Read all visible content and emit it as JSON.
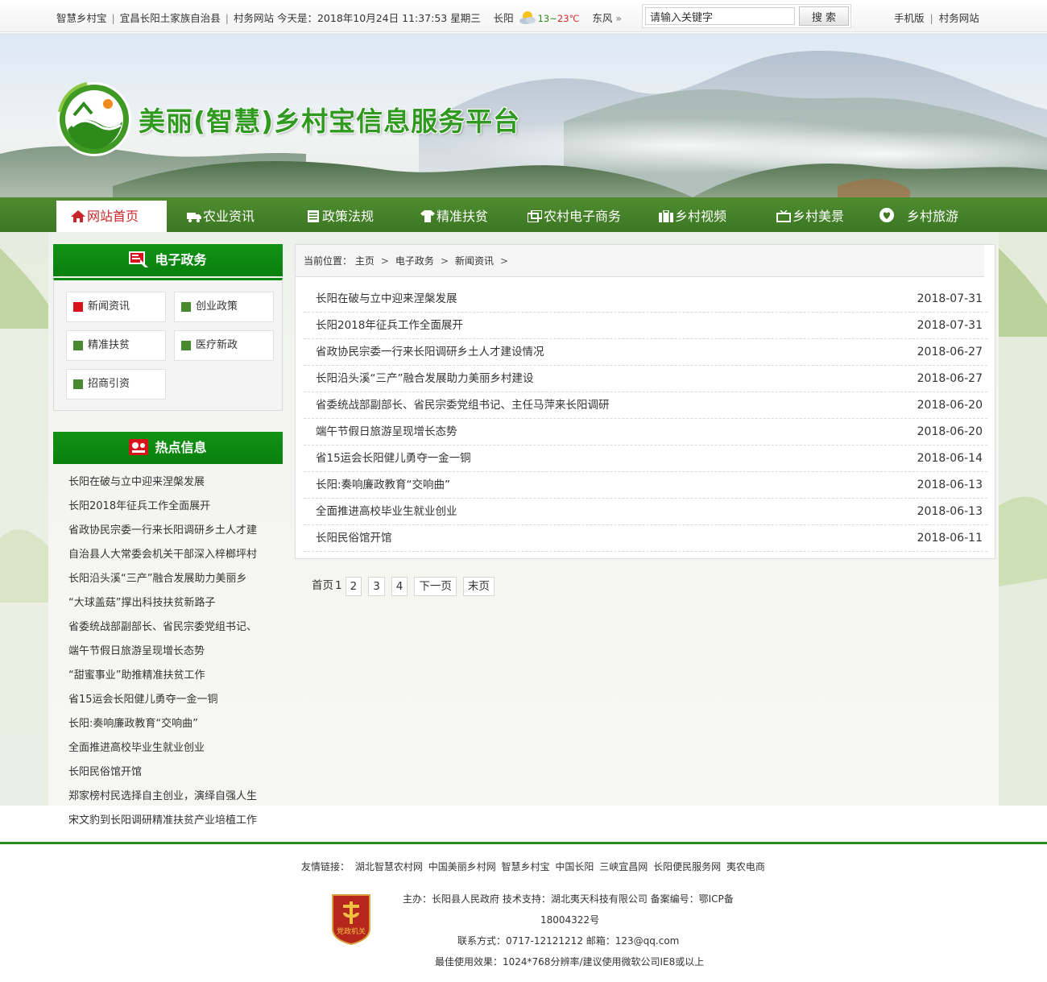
{
  "topbar": {
    "site_name": "智慧乡村宝",
    "county": "宜昌长阳土家族自治县",
    "village_site": "村务网站",
    "date_prefix": "今天是：",
    "datetime": "2018年10月24日 11:37:53 星期三",
    "city": "长阳",
    "temp_low": "13",
    "temp_sep": "~",
    "temp_high": "23℃",
    "wind": "东风",
    "more_glyph": "»",
    "weather_icon": "sun-cloud-icon",
    "mobile": "手机版",
    "village_link": "村务网站"
  },
  "search": {
    "placeholder": "请输入关键字",
    "button": "搜 索"
  },
  "banner": {
    "title": "美丽(智慧)乡村宝信息服务平台"
  },
  "nav": {
    "items": [
      {
        "label": "网站首页",
        "icon": "home-icon"
      },
      {
        "label": "农业资讯",
        "icon": "truck-icon"
      },
      {
        "label": "政策法规",
        "icon": "document-icon"
      },
      {
        "label": "精准扶贫",
        "icon": "shirt-icon"
      },
      {
        "label": "农村电子商务",
        "icon": "cards-icon"
      },
      {
        "label": "乡村视频",
        "icon": "briefcase-icon"
      },
      {
        "label": "乡村美景",
        "icon": "tv-icon"
      },
      {
        "label": "乡村旅游",
        "icon": "heart-icon"
      }
    ]
  },
  "sidebar": {
    "egov_title": "电子政务",
    "egov_items": [
      "新闻资讯",
      "创业政策",
      "精准扶贫",
      "医疗新政",
      "招商引资"
    ],
    "hot_title": "热点信息",
    "hot_items": [
      "长阳在破与立中迎来涅槃发展",
      "长阳2018年征兵工作全面展开",
      "省政协民宗委一行来长阳调研乡土人才建",
      "自治县人大常委会机关干部深入梓榔坪村",
      "长阳沿头溪“三产”融合发展助力美丽乡",
      "“大球盖菇”撑出科技扶贫新路子",
      "省委统战部副部长、省民宗委党组书记、",
      "端午节假日旅游呈现增长态势",
      "“甜蜜事业”助推精准扶贫工作",
      "省15运会长阳健儿勇夺一金一铜",
      "长阳:奏响廉政教育“交响曲”",
      "全面推进高校毕业生就业创业",
      "长阳民俗馆开馆",
      "郑家榜村民选择自主创业，演绎自强人生",
      "宋文豹到长阳调研精准扶贫产业培植工作"
    ]
  },
  "breadcrumb": {
    "label": "当前位置：",
    "items": [
      "主页",
      "电子政务",
      "新闻资讯"
    ],
    "arrow": ">"
  },
  "news": [
    {
      "title": "长阳在破与立中迎来涅槃发展",
      "date": "2018-07-31"
    },
    {
      "title": "长阳2018年征兵工作全面展开",
      "date": "2018-07-31"
    },
    {
      "title": "省政协民宗委一行来长阳调研乡土人才建设情况",
      "date": "2018-06-27"
    },
    {
      "title": "长阳沿头溪“三产”融合发展助力美丽乡村建设",
      "date": "2018-06-27"
    },
    {
      "title": "省委统战部副部长、省民宗委党组书记、主任马萍来长阳调研",
      "date": "2018-06-20"
    },
    {
      "title": "端午节假日旅游呈现增长态势",
      "date": "2018-06-20"
    },
    {
      "title": "省15运会长阳健儿勇夺一金一铜",
      "date": "2018-06-14"
    },
    {
      "title": "长阳:奏响廉政教育“交响曲”",
      "date": "2018-06-13"
    },
    {
      "title": "全面推进高校毕业生就业创业",
      "date": "2018-06-13"
    },
    {
      "title": "长阳民俗馆开馆",
      "date": "2018-06-11"
    }
  ],
  "pager": {
    "first": "首页",
    "current": "1",
    "pages": [
      "2",
      "3",
      "4"
    ],
    "next": "下一页",
    "last": "末页"
  },
  "footer": {
    "links_label": "友情链接：",
    "links": [
      "湖北智慧农村网",
      "中国美丽乡村网",
      "智慧乡村宝",
      "中国长阳",
      "三峡宜昌网",
      "长阳便民服务网",
      "夷农电商"
    ],
    "host": "主办：长阳县人民政府 技术支持：湖北夷天科技有限公司 备案编号：鄂ICP备",
    "icp": "18004322号",
    "contact": "联系方式：0717-12121212   邮箱：123@qq.com",
    "best": "最佳使用效果：1024*768分辨率/建议使用微软公司IE8或以上",
    "badge_text": "党政机关"
  },
  "colors": {
    "nav_green": "#3f7a26",
    "side_head_green": "#0c8a12",
    "active_red": "#c8262a",
    "footer_line": "#2a8c1f"
  }
}
